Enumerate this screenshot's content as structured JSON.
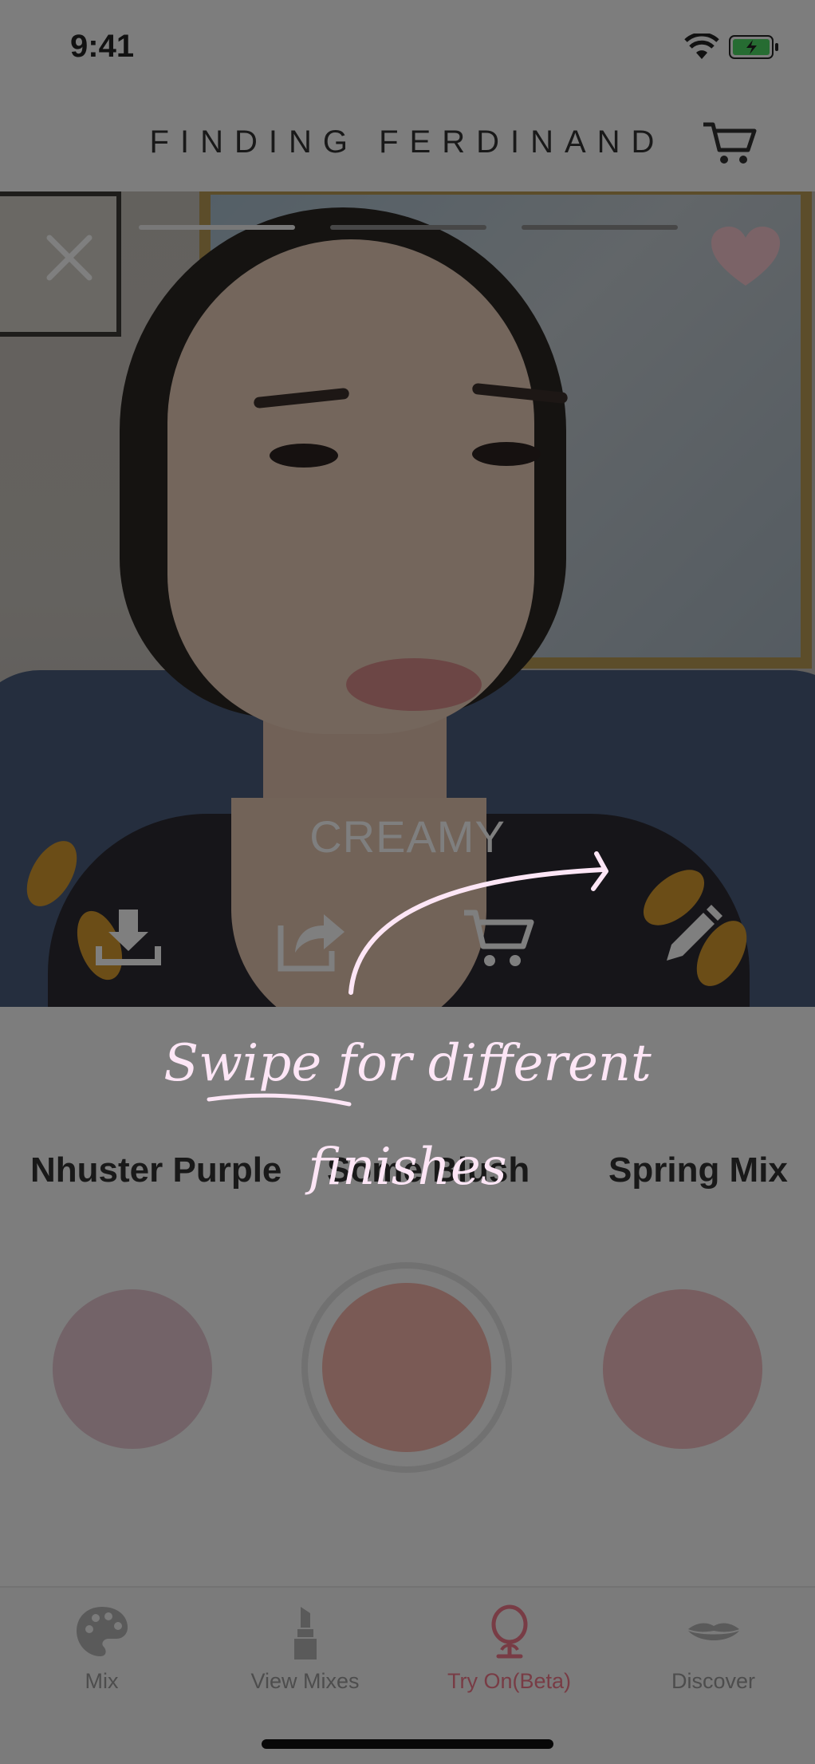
{
  "status_bar": {
    "time": "9:41"
  },
  "header": {
    "brand": "FINDING FERDINAND"
  },
  "photo": {
    "finish_label": "CREAMY",
    "progress_segments": [
      {
        "active": true
      },
      {
        "active": false
      },
      {
        "active": false
      }
    ]
  },
  "shades": [
    {
      "name": "Nhuster Purple",
      "color": "#e6c7d0"
    },
    {
      "name": "Some Blush",
      "color": "#f4b5ab"
    },
    {
      "name": "Spring Mix",
      "color": "#f1bcc0"
    }
  ],
  "tabs": [
    {
      "label": "Mix",
      "icon": "palette-icon",
      "active": false
    },
    {
      "label": "View Mixes",
      "icon": "lipstick-icon",
      "active": false
    },
    {
      "label": "Try On(Beta)",
      "icon": "mirror-icon",
      "active": true
    },
    {
      "label": "Discover",
      "icon": "lips-icon",
      "active": false
    }
  ],
  "overlay": {
    "hint_line1": "Swipe for different",
    "hint_line2": "finishes"
  },
  "colors": {
    "accent": "#f0788a",
    "hint_text": "#fde6f6"
  }
}
